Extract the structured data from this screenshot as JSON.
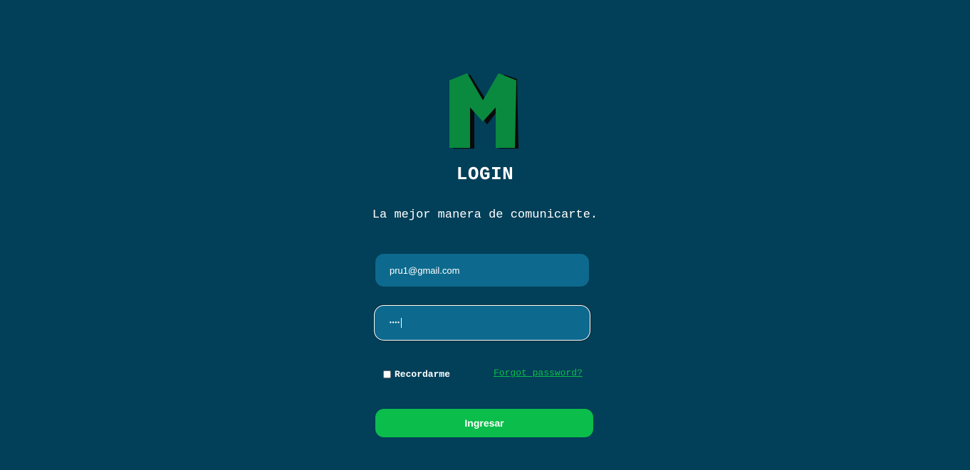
{
  "logo": {
    "icon": "m-letter-logo-icon",
    "brand_color": "#0a8a3f"
  },
  "login": {
    "title": "LOGIN",
    "subtitle": "La mejor manera de comunicarte.",
    "email_value": "pru1@gmail.com",
    "password_masked": "••••",
    "remember_label": "Recordarme",
    "remember_checked": false,
    "forgot_label": "Forgot password?",
    "submit_label": "Ingresar"
  },
  "colors": {
    "background": "#023f58",
    "input": "#0d6a8e",
    "accent": "#0bbd4b"
  }
}
